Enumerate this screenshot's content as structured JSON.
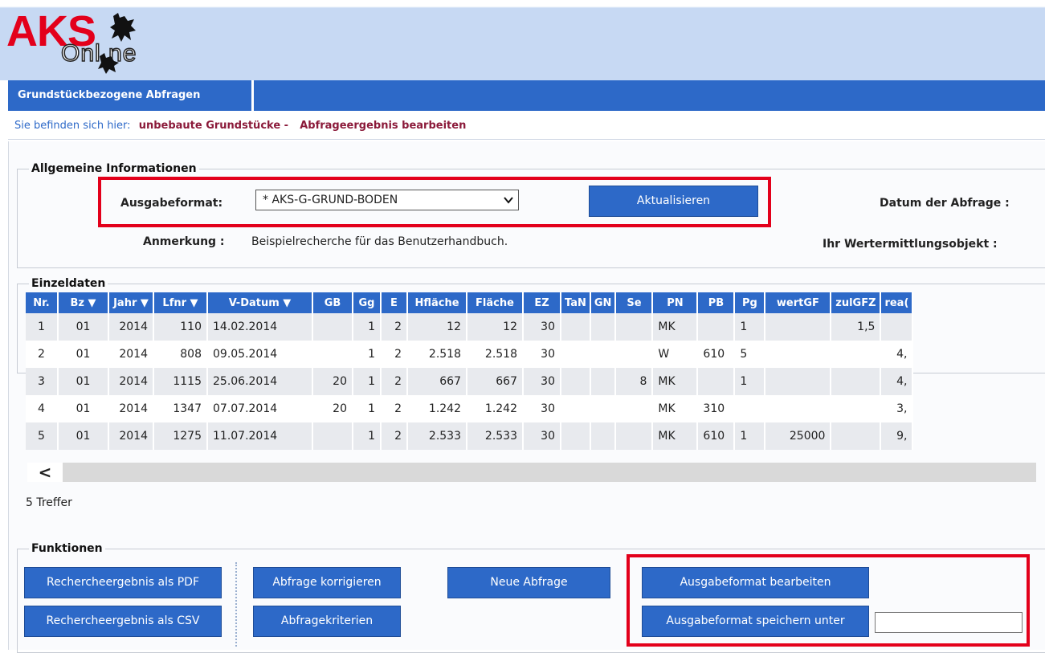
{
  "logo": {
    "aks": "AKS",
    "online": "Onl ne"
  },
  "nav": {
    "tab_label": "Grundstückbezogene Abfragen"
  },
  "breadcrumb": {
    "prefix": "Sie befinden sich hier:",
    "item1": "unbebaute Grundstücke -",
    "item2": "Abfrageergebnis bearbeiten"
  },
  "general": {
    "legend": "Allgemeine Informationen",
    "format_label": "Ausgabeformat:",
    "format_value": "* AKS-G-GRUND-BODEN",
    "update_button": "Aktualisieren",
    "date_label": "Datum der Abfrage :",
    "note_label": "Anmerkung :",
    "note_value": "Beispielrecherche für das Benutzerhandbuch.",
    "object_label": "Ihr Wertermittlungsobjekt :"
  },
  "einzeldaten": {
    "legend": "Einzeldaten",
    "columns": [
      "Nr.",
      "Bz ▼",
      "Jahr ▼",
      "Lfnr ▼",
      "V-Datum ▼",
      "GB",
      "Gg",
      "E",
      "Hfläche",
      "Fläche",
      "EZ",
      "TaN",
      "GN",
      "Se",
      "PN",
      "PB",
      "Pg",
      "wertGF",
      "zulGFZ",
      "rea("
    ],
    "rows": [
      [
        "1",
        "01",
        "2014",
        "110",
        "14.02.2014",
        "",
        "1",
        "2",
        "12",
        "12",
        "30",
        "",
        "",
        "",
        "MK",
        "",
        "1",
        "",
        "1,5",
        ""
      ],
      [
        "2",
        "01",
        "2014",
        "808",
        "09.05.2014",
        "",
        "1",
        "2",
        "2.518",
        "2.518",
        "30",
        "",
        "",
        "",
        "W",
        "610",
        "5",
        "",
        "",
        "4,"
      ],
      [
        "3",
        "01",
        "2014",
        "1115",
        "25.06.2014",
        "20",
        "1",
        "2",
        "667",
        "667",
        "30",
        "",
        "",
        "8",
        "MK",
        "",
        "1",
        "",
        "",
        "4,"
      ],
      [
        "4",
        "01",
        "2014",
        "1347",
        "07.07.2014",
        "20",
        "1",
        "2",
        "1.242",
        "1.242",
        "30",
        "",
        "",
        "",
        "MK",
        "310",
        "",
        "",
        "",
        "3,"
      ],
      [
        "5",
        "01",
        "2014",
        "1275",
        "11.07.2014",
        "",
        "1",
        "2",
        "2.533",
        "2.533",
        "30",
        "",
        "",
        "",
        "MK",
        "610",
        "1",
        "25000",
        "",
        "9,"
      ]
    ],
    "scroll_left": "<",
    "hits": "5 Treffer"
  },
  "functions": {
    "legend": "Funktionen",
    "pdf_button": "Rechercheergebnis als PDF",
    "csv_button": "Rechercheergebnis als CSV",
    "correct_button": "Abfrage korrigieren",
    "criteria_button": "Abfragekriterien",
    "new_button": "Neue Abfrage",
    "edit_format_button": "Ausgabeformat bearbeiten",
    "save_format_button": "Ausgabeformat speichern unter"
  },
  "colors": {
    "accent": "#2d69c8",
    "highlight": "#e3001b",
    "breadcrumb": "#8b1a3a"
  }
}
